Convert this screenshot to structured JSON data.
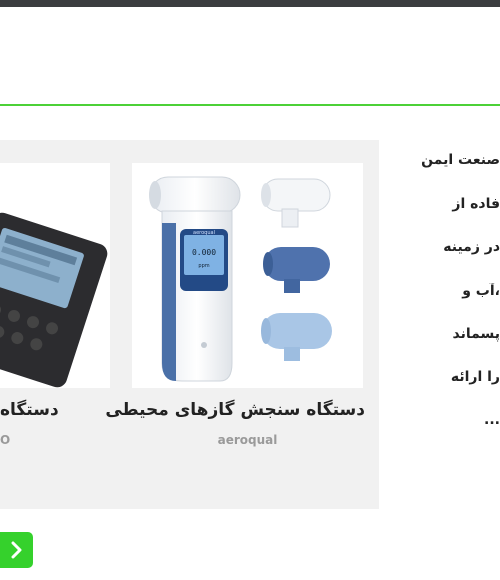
{
  "products": [
    {
      "title": "دستگاه سنجش گازهای محیطی",
      "brand": "aeroqual"
    },
    {
      "title": "دستگاه",
      "brand": "O"
    }
  ],
  "intro_lines": [
    "صنعت ایمن",
    "فاده از",
    "در زمینه",
    "،آب و",
    "پسماند",
    "را ارائه",
    "..."
  ],
  "device_screen": {
    "brand": "aeroqual",
    "reading": "0.000",
    "unit": "ppm"
  },
  "colors": {
    "accent": "#35d12c",
    "topbar": "#3b3d3f",
    "panel": "#f1f1f1"
  },
  "icons": {
    "next": "chevron-right-icon"
  }
}
